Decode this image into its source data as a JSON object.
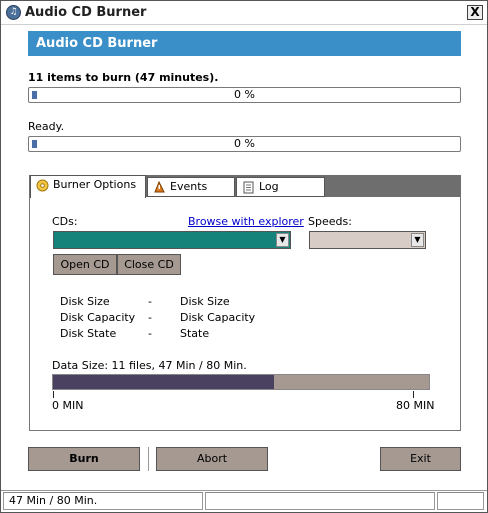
{
  "window": {
    "title": "Audio CD Burner",
    "close_glyph": "X",
    "icon": "cd-icon"
  },
  "banner": {
    "title": "Audio CD Burner",
    "color": "#3b8fc8"
  },
  "progress": {
    "items_label": "11 items to burn (47 minutes).",
    "items_percent_text": "0 %",
    "items_value": 0,
    "status_label": "Ready.",
    "status_percent_text": "0 %",
    "status_value": 0
  },
  "tabs": [
    {
      "label": "Burner Options",
      "icon": "burner-options-icon",
      "active": true
    },
    {
      "label": "Events",
      "icon": "events-icon",
      "active": false
    },
    {
      "label": "Log",
      "icon": "log-icon",
      "active": false
    }
  ],
  "burner_options": {
    "cds_label": "CDs:",
    "browse_link": "Browse with explorer",
    "speeds_label": "Speeds:",
    "cd_select_value": "",
    "speed_select_value": "",
    "open_cd_label": "Open CD",
    "close_cd_label": "Close CD",
    "disk_info": [
      {
        "name": "Disk Size",
        "sep": "-",
        "value": "Disk Size"
      },
      {
        "name": "Disk Capacity",
        "sep": "-",
        "value": "Disk Capacity"
      },
      {
        "name": "Disk State",
        "sep": "-",
        "value": "State"
      }
    ],
    "data_size_label": "Data Size: 11 files, 47 Min / 80 Min.",
    "data_used_min": 47,
    "data_total_min": 80,
    "scale_min_label": "0 MIN",
    "scale_max_label": "80 MIN"
  },
  "buttons": {
    "burn": "Burn",
    "abort": "Abort",
    "exit": "Exit"
  },
  "statusbar": {
    "text": "47 Min / 80 Min.",
    "segment2": "",
    "segment3": ""
  },
  "colors": {
    "cd_select": "#16837a",
    "speed_select": "#d7cdc6",
    "button": "#a59992",
    "progress_fill": "#4a4060"
  }
}
